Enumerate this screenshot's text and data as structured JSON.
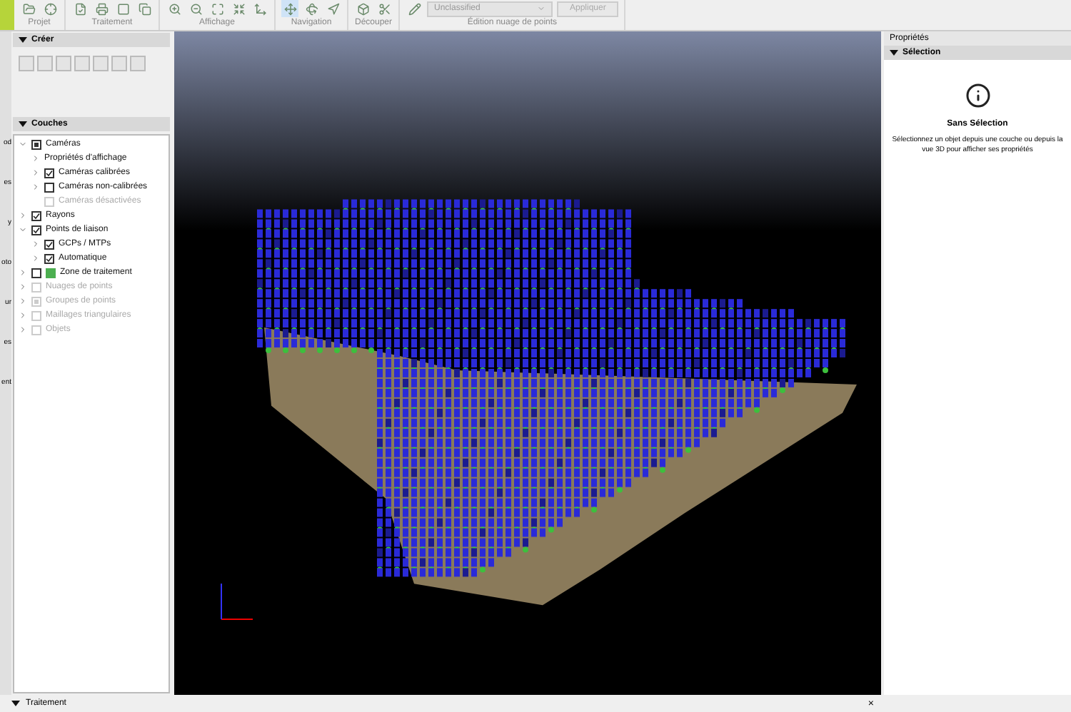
{
  "toolbar": {
    "groups": [
      {
        "label": "Projet",
        "tools": [
          {
            "selected": false
          },
          {
            "selected": false
          }
        ]
      },
      {
        "label": "Traitement",
        "tools": [
          {
            "selected": false
          },
          {
            "selected": false
          },
          {
            "selected": false
          },
          {
            "selected": false
          }
        ]
      },
      {
        "label": "Affichage",
        "tools": [
          {
            "selected": false
          },
          {
            "selected": false
          },
          {
            "selected": false
          },
          {
            "selected": false
          },
          {
            "selected": false
          }
        ]
      },
      {
        "label": "Navigation",
        "tools": [
          {
            "selected": true
          },
          {
            "selected": false
          },
          {
            "selected": false
          }
        ]
      },
      {
        "label": "Découper",
        "tools": [
          {
            "selected": false
          },
          {
            "selected": false
          }
        ]
      },
      {
        "label": "Édition nuage de points",
        "tools": [
          {
            "selected": false
          }
        ]
      }
    ],
    "class_select": {
      "value": "Unclassified"
    },
    "apply_button": {
      "label": "Appliquer",
      "disabled": true
    }
  },
  "left_strip": [
    "od",
    "es",
    "y",
    "oto",
    "ur",
    "es",
    "ent"
  ],
  "create_panel": {
    "title": "Créer"
  },
  "layers_panel": {
    "title": "Couches",
    "tree": [
      {
        "label": "Caméras",
        "kind": "tristate",
        "checked": true,
        "expanded": true,
        "disabled": false,
        "children": [
          {
            "label": "Propriétés d'affichage",
            "kind": "label",
            "expanded": false,
            "disabled": false
          },
          {
            "label": "Caméras calibrées",
            "kind": "checkbox",
            "checked": true,
            "expanded": false,
            "disabled": false
          },
          {
            "label": "Caméras non-calibrées",
            "kind": "checkbox",
            "checked": false,
            "expanded": false,
            "disabled": false
          },
          {
            "label": "Caméras désactivées",
            "kind": "checkbox",
            "checked": false,
            "disabled": true
          }
        ]
      },
      {
        "label": "Rayons",
        "kind": "checkbox",
        "checked": true,
        "expanded": false,
        "disabled": false
      },
      {
        "label": "Points de liaison",
        "kind": "checkbox",
        "checked": true,
        "expanded": true,
        "disabled": false,
        "children": [
          {
            "label": "GCPs / MTPs",
            "kind": "checkbox",
            "checked": true,
            "expanded": false,
            "disabled": false
          },
          {
            "label": "Automatique",
            "kind": "checkbox",
            "checked": true,
            "expanded": false,
            "disabled": false
          }
        ]
      },
      {
        "label": "Zone de traitement",
        "kind": "checkbox",
        "checked": false,
        "expanded": false,
        "disabled": false,
        "color": "#4caf50"
      },
      {
        "label": "Nuages de points",
        "kind": "checkbox",
        "checked": false,
        "expanded": false,
        "disabled": true
      },
      {
        "label": "Groupes de points",
        "kind": "tristate",
        "checked": true,
        "expanded": false,
        "disabled": true
      },
      {
        "label": "Maillages triangulaires",
        "kind": "checkbox",
        "checked": false,
        "expanded": false,
        "disabled": true
      },
      {
        "label": "Objets",
        "kind": "checkbox",
        "checked": false,
        "expanded": false,
        "disabled": true
      }
    ]
  },
  "properties_panel": {
    "title": "Propriétés",
    "section": "Sélection",
    "heading": "Sans Sélection",
    "message": "Sélectionnez un objet depuis une couche ou depuis la vue 3D pour afficher ses propriétés"
  },
  "bottom_panel": {
    "title": "Traitement",
    "close": "×"
  }
}
